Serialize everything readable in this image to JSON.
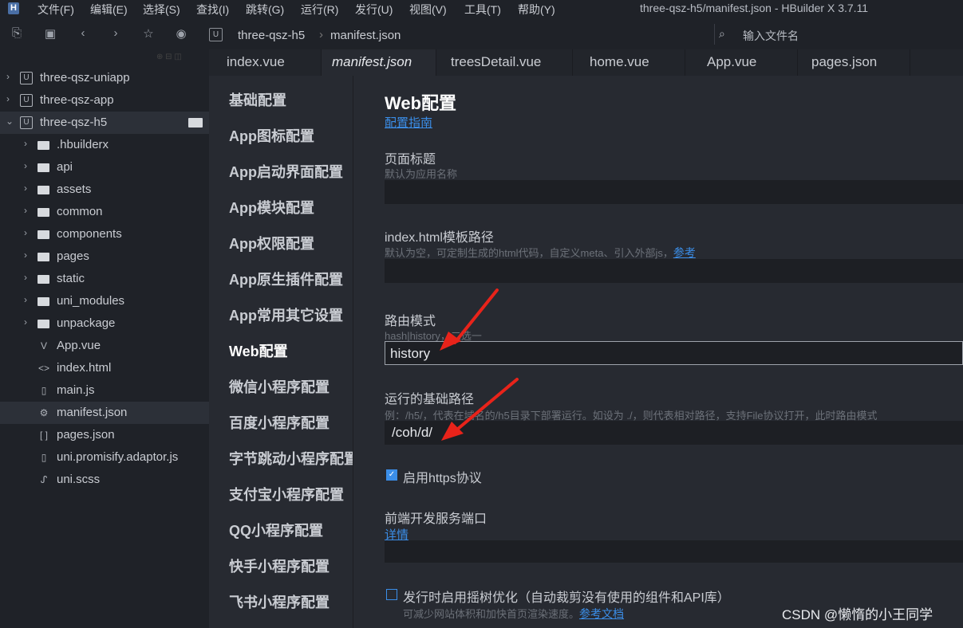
{
  "menubar": {
    "logo": "H",
    "items": [
      "文件(F)",
      "编辑(E)",
      "选择(S)",
      "查找(I)",
      "跳转(G)",
      "运行(R)",
      "发行(U)",
      "视图(V)",
      "工具(T)",
      "帮助(Y)"
    ],
    "window_title": "three-qsz-h5/manifest.json - HBuilder X 3.7.11"
  },
  "toolbar": {
    "breadcrumb": [
      "three-qsz-h5",
      "manifest.json"
    ],
    "search_placeholder": "输入文件名"
  },
  "sidebar": {
    "items": [
      {
        "label": "three-qsz-uniapp",
        "kind": "project",
        "expanded": false
      },
      {
        "label": "three-qsz-app",
        "kind": "project",
        "expanded": false
      },
      {
        "label": "three-qsz-h5",
        "kind": "project",
        "expanded": true
      },
      {
        "label": ".hbuilderx",
        "kind": "folder"
      },
      {
        "label": "api",
        "kind": "folder"
      },
      {
        "label": "assets",
        "kind": "folder"
      },
      {
        "label": "common",
        "kind": "folder"
      },
      {
        "label": "components",
        "kind": "folder"
      },
      {
        "label": "pages",
        "kind": "folder"
      },
      {
        "label": "static",
        "kind": "folder"
      },
      {
        "label": "uni_modules",
        "kind": "folder"
      },
      {
        "label": "unpackage",
        "kind": "folder"
      },
      {
        "label": "App.vue",
        "kind": "vue"
      },
      {
        "label": "index.html",
        "kind": "html"
      },
      {
        "label": "main.js",
        "kind": "file"
      },
      {
        "label": "manifest.json",
        "kind": "gear",
        "selected": true
      },
      {
        "label": "pages.json",
        "kind": "json"
      },
      {
        "label": "uni.promisify.adaptor.js",
        "kind": "file"
      },
      {
        "label": "uni.scss",
        "kind": "scss"
      }
    ]
  },
  "tabs": [
    "index.vue",
    "manifest.json",
    "treesDetail.vue",
    "home.vue",
    "App.vue",
    "pages.json"
  ],
  "active_tab": "manifest.json",
  "config_nav": [
    "基础配置",
    "App图标配置",
    "App启动界面配置",
    "App模块配置",
    "App权限配置",
    "App原生插件配置",
    "App常用其它设置",
    "Web配置",
    "微信小程序配置",
    "百度小程序配置",
    "字节跳动小程序配置",
    "支付宝小程序配置",
    "QQ小程序配置",
    "快手小程序配置",
    "飞书小程序配置"
  ],
  "active_nav": "Web配置",
  "content": {
    "heading": "Web配置",
    "guide_link": "配置指南",
    "page_title_label": "页面标题",
    "page_title_hint": "默认为应用名称",
    "page_title_value": "",
    "template_label": "index.html模板路径",
    "template_hint": "默认为空，可定制生成的html代码，自定义meta、引入外部js，",
    "template_hint_link": "参考",
    "template_value": "",
    "router_label": "路由模式",
    "router_hint": "hash|history，二选一",
    "router_value": "history",
    "base_label": "运行的基础路径",
    "base_hint": "例：/h5/，代表在域名的/h5目录下部署运行。如设为 ./，则代表相对路径，支持File协议打开，此时路由模式",
    "base_value": "/coh/d/",
    "https_label": "启用https协议",
    "https_checked": true,
    "port_label": "前端开发服务端口",
    "port_link": "详情",
    "port_value": "",
    "treeshake_label": "发行时启用摇树优化（自动裁剪没有使用的组件和API库）",
    "treeshake_checked": false,
    "treeshake_hint": "可减少网站体积和加快首页渲染速度。",
    "treeshake_link": "参考文档"
  },
  "watermark": "CSDN @懒惰的小王同学",
  "colors": {
    "accent": "#3b8ee8",
    "arrow": "#e8231a",
    "bg": "#272a31",
    "sidebar": "#1f2228"
  }
}
